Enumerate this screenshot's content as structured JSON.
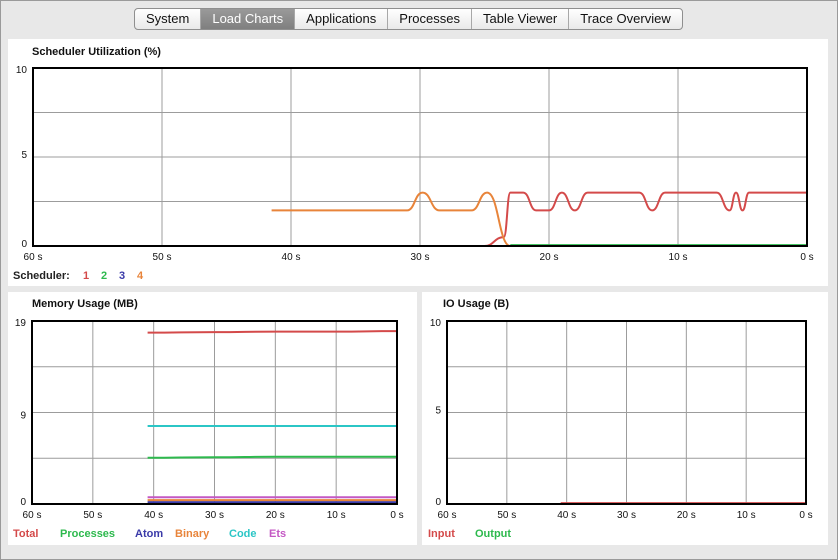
{
  "tabs": [
    {
      "label": "System",
      "active": false
    },
    {
      "label": "Load Charts",
      "active": true
    },
    {
      "label": "Applications",
      "active": false
    },
    {
      "label": "Processes",
      "active": false
    },
    {
      "label": "Table Viewer",
      "active": false
    },
    {
      "label": "Trace Overview",
      "active": false
    }
  ],
  "chart_data": [
    {
      "type": "line",
      "title": "Scheduler Utilization (%)",
      "x_ticks": [
        "60 s",
        "50 s",
        "40 s",
        "30 s",
        "20 s",
        "10 s",
        "0 s"
      ],
      "xlim": [
        60,
        0
      ],
      "y_ticks": [
        "0",
        "5",
        "10"
      ],
      "ylim": [
        0,
        10
      ],
      "grid": true,
      "legend_title": "Scheduler:",
      "series": [
        {
          "name": "1",
          "color": "#d44a4a",
          "x": [
            41.5,
            25,
            23.5,
            23,
            22,
            21,
            20,
            19,
            18,
            17,
            16,
            15,
            14,
            13,
            12,
            11,
            10,
            9,
            8,
            7,
            6,
            5.5,
            5,
            4.5,
            4,
            3,
            2,
            1,
            0
          ],
          "values": [
            0,
            0,
            0.5,
            3,
            3,
            2,
            2,
            3,
            2,
            3,
            3,
            3,
            3,
            3,
            2,
            3,
            3,
            3,
            3,
            3,
            2,
            3,
            2,
            3,
            3,
            3,
            3,
            3,
            3
          ]
        },
        {
          "name": "2",
          "color": "#2db94d",
          "x": [
            23,
            0
          ],
          "values": [
            0.05,
            0.05
          ]
        },
        {
          "name": "3",
          "color": "#3a3aa8",
          "x": [],
          "values": []
        },
        {
          "name": "4",
          "color": "#e8843a",
          "x": [
            41.5,
            31,
            29.8,
            28.5,
            26,
            24.8,
            23,
            0
          ],
          "values": [
            2,
            2,
            3,
            2,
            2,
            3,
            0,
            0
          ]
        }
      ]
    },
    {
      "type": "line",
      "title": "Memory Usage (MB)",
      "x_ticks": [
        "60 s",
        "50 s",
        "40 s",
        "30 s",
        "20 s",
        "10 s",
        "0 s"
      ],
      "xlim": [
        60,
        0
      ],
      "y_ticks": [
        "0",
        "9",
        "19"
      ],
      "ylim": [
        0,
        19
      ],
      "grid": true,
      "series": [
        {
          "name": "Total",
          "color": "#d44a4a",
          "x": [
            41,
            30,
            20,
            10,
            0
          ],
          "values": [
            17.8,
            17.85,
            17.9,
            17.9,
            17.95
          ]
        },
        {
          "name": "Processes",
          "color": "#2db94d",
          "x": [
            41,
            30,
            20,
            10,
            0
          ],
          "values": [
            4.8,
            4.85,
            4.9,
            4.9,
            4.9
          ]
        },
        {
          "name": "Atom",
          "color": "#3a3aa8",
          "x": [
            41,
            0
          ],
          "values": [
            0.2,
            0.2
          ]
        },
        {
          "name": "Binary",
          "color": "#e8843a",
          "x": [
            41,
            0
          ],
          "values": [
            0.4,
            0.4
          ]
        },
        {
          "name": "Code",
          "color": "#2bc6c6",
          "x": [
            41,
            0
          ],
          "values": [
            8.1,
            8.1
          ]
        },
        {
          "name": "Ets",
          "color": "#c458c4",
          "x": [
            41,
            0
          ],
          "values": [
            0.7,
            0.7
          ]
        }
      ]
    },
    {
      "type": "line",
      "title": "IO Usage (B)",
      "x_ticks": [
        "60 s",
        "50 s",
        "40 s",
        "30 s",
        "20 s",
        "10 s",
        "0 s"
      ],
      "xlim": [
        60,
        0
      ],
      "y_ticks": [
        "0",
        "5",
        "10"
      ],
      "ylim": [
        0,
        10
      ],
      "grid": true,
      "series": [
        {
          "name": "Input",
          "color": "#d44a4a",
          "x": [
            41,
            0
          ],
          "values": [
            0.05,
            0.05
          ]
        },
        {
          "name": "Output",
          "color": "#2db94d",
          "x": [
            41,
            0
          ],
          "values": [
            0,
            0
          ]
        }
      ]
    }
  ]
}
